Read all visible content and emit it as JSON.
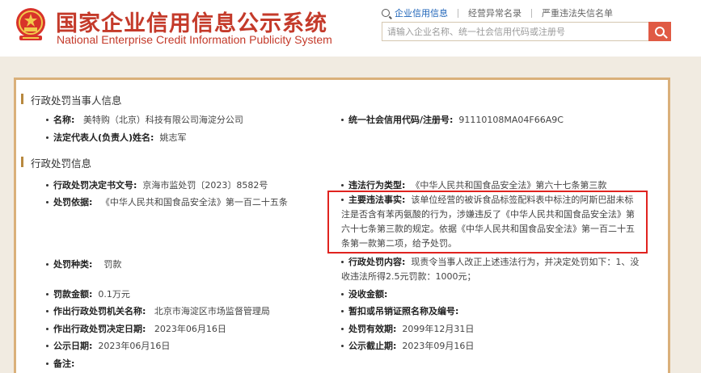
{
  "header": {
    "title_cn": "国家企业信用信息公示系统",
    "title_en": "National Enterprise Credit Information Publicity System",
    "nav": {
      "credit_info": "企业信用信息",
      "abnormal_list": "经营异常名录",
      "serious_violation_list": "严重违法失信名单"
    },
    "search": {
      "placeholder": "请输入企业名称、统一社会信用代码或注册号"
    }
  },
  "party_section": {
    "title": "行政处罚当事人信息",
    "name_label": "名称:",
    "name_value": "美特购（北京）科技有限公司海淀分公司",
    "credit_code_label": "统一社会信用代码/注册号:",
    "credit_code_value": "91110108MA04F66A9C",
    "legal_rep_label": "法定代表人(负责人)姓名:",
    "legal_rep_value": "姚志军"
  },
  "penalty_section": {
    "title": "行政处罚信息",
    "decision_no_label": "行政处罚决定书文号:",
    "decision_no_value": "京海市监处罚〔2023〕8582号",
    "violation_type_label": "违法行为类型:",
    "violation_type_value": "《中华人民共和国食品安全法》第六十七条第三款",
    "basis_label": "处罚依据:",
    "basis_value": "《中华人民共和国食品安全法》第一百二十五条",
    "main_facts_label": "主要违法事实:",
    "main_facts_value": "该单位经营的被诉食品标签配料表中标注的阿斯巴甜未标注是否含有苯丙氨酸的行为，涉嫌违反了《中华人民共和国食品安全法》第六十七条第三款的规定。依据《中华人民共和国食品安全法》第一百二十五条第一款第二项，给予处罚。",
    "penalty_type_label": "处罚种类:",
    "penalty_type_value": "罚款",
    "content_label": "行政处罚内容:",
    "content_value": "现责令当事人改正上述违法行为，并决定处罚如下：1、没收违法所得2.5元罚款：1000元；",
    "fine_label": "罚款金额:",
    "fine_value": "0.1万元",
    "confiscation_label": "没收金额:",
    "confiscation_value": "",
    "authority_label": "作出行政处罚机关名称:",
    "authority_value": "北京市海淀区市场监督管理局",
    "license_label": "暂扣或吊销证照名称及编号:",
    "license_value": "",
    "decision_date_label": "作出行政处罚决定日期:",
    "decision_date_value": "2023年06月16日",
    "validity_label": "处罚有效期:",
    "validity_value": "2099年12月31日",
    "publish_date_label": "公示日期:",
    "publish_date_value": "2023年06月16日",
    "publish_end_label": "公示截止期:",
    "publish_end_value": "2023年09月16日",
    "remark_label": "备注:"
  }
}
